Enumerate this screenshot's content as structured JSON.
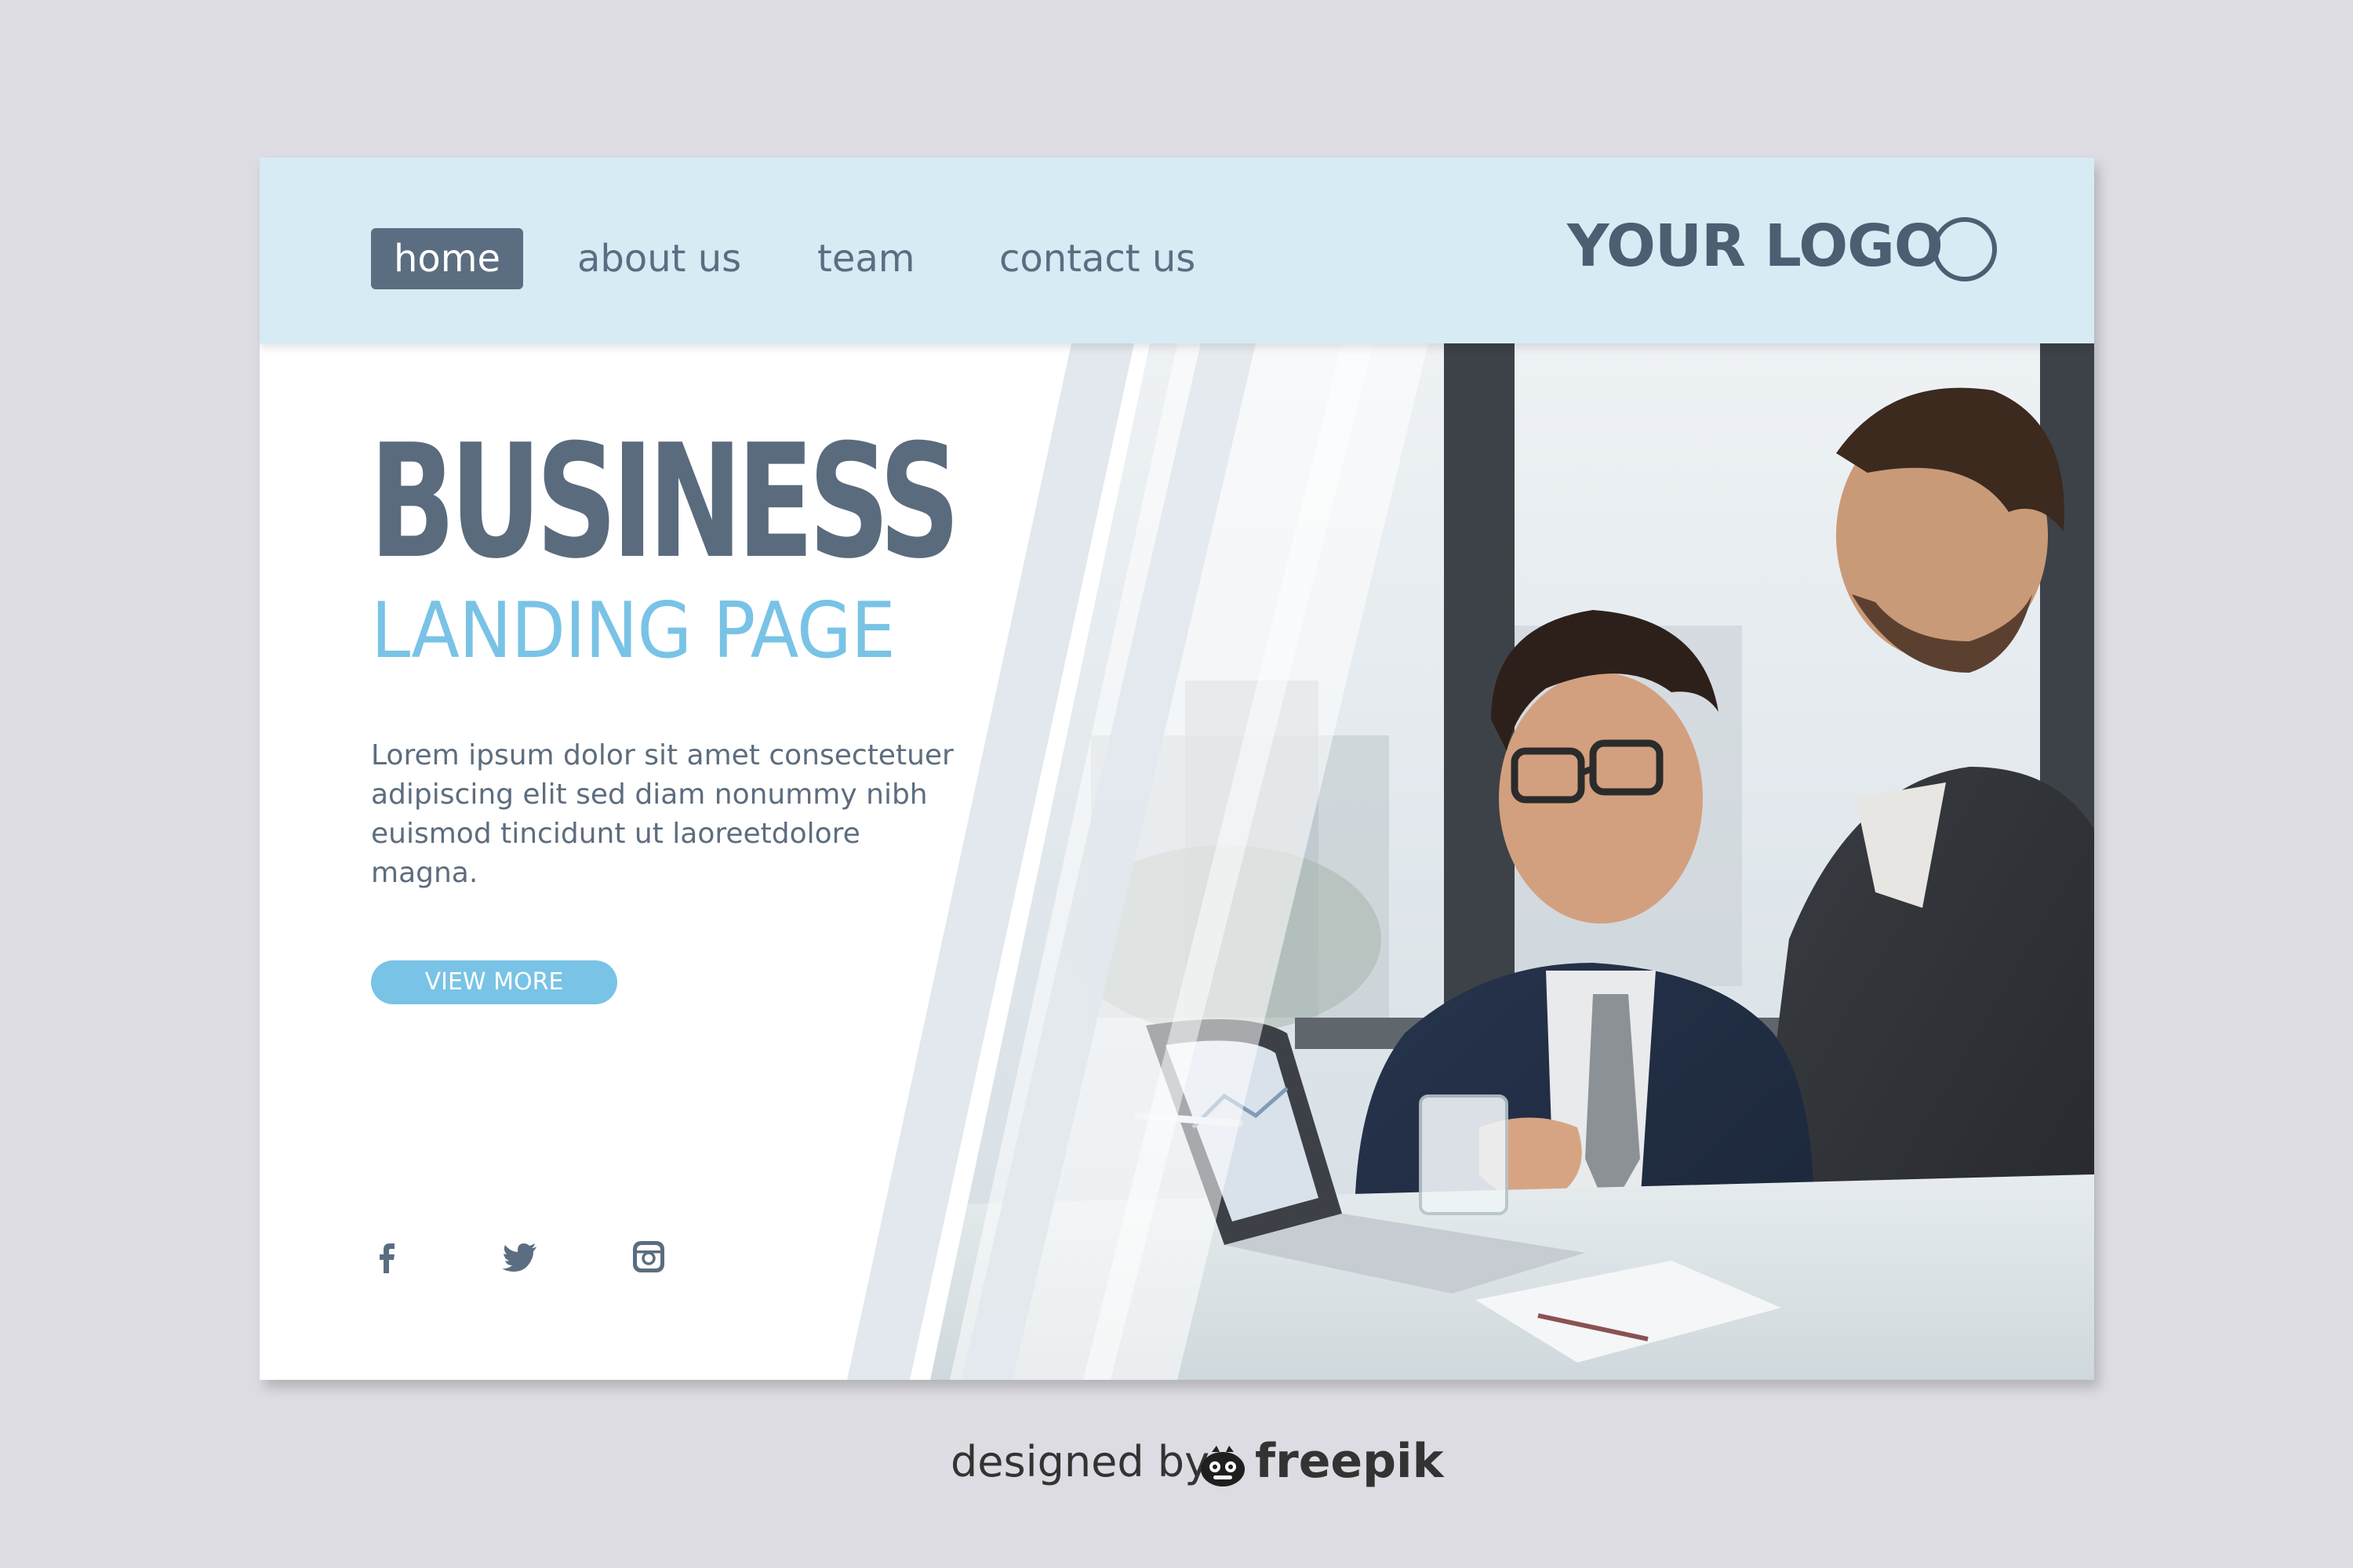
{
  "nav": {
    "items": [
      {
        "label": "home",
        "active": true
      },
      {
        "label": "about us",
        "active": false
      },
      {
        "label": "team",
        "active": false
      },
      {
        "label": "contact us",
        "active": false
      }
    ],
    "logo_text": "YOUR LOGO"
  },
  "hero": {
    "title": "BUSINESS",
    "subtitle": "LANDING PAGE",
    "description": "Lorem ipsum dolor sit amet consectetuer adipiscing elit sed diam nonummy nibh euismod tincidunt ut laoreetdolore magna.",
    "cta_label": "VIEW MORE",
    "photo_icon": "business-meeting-photo"
  },
  "social": {
    "icons": [
      "facebook-icon",
      "twitter-icon",
      "instagram-icon"
    ]
  },
  "credit": {
    "prefix": "designed by",
    "brand": "freepik",
    "icon": "freepik-mascot-icon"
  },
  "colors": {
    "page_background": "#dcdce2",
    "navbar_background": "#d6ebf4",
    "primary_text": "#5a6b7e",
    "accent": "#79c3e6",
    "active_nav_background": "#5b6d80",
    "card_background": "#ffffff"
  }
}
